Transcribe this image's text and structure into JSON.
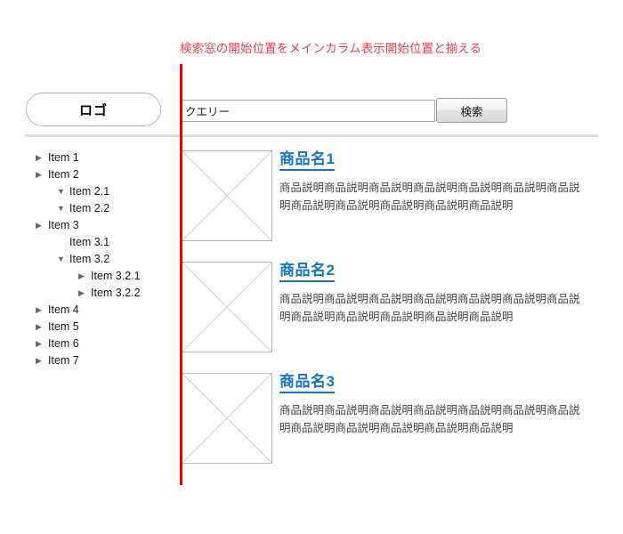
{
  "annotation": {
    "text": "検索窓の開始位置をメインカラム表示開始位置と揃える",
    "color": "#ee3b4d"
  },
  "guide_line": {
    "color": "#e60000"
  },
  "header": {
    "logo_label": "ロゴ",
    "search_value": "クエリー",
    "search_placeholder": "クエリー",
    "search_button_label": "検索"
  },
  "sidebar": {
    "items": [
      {
        "label": "Item 1",
        "depth": 0,
        "arrow": "collapsed"
      },
      {
        "label": "Item 2",
        "depth": 0,
        "arrow": "collapsed"
      },
      {
        "label": "Item 2.1",
        "depth": 1,
        "arrow": "expanded"
      },
      {
        "label": "Item 2.2",
        "depth": 1,
        "arrow": "expanded"
      },
      {
        "label": "Item 3",
        "depth": 0,
        "arrow": "collapsed"
      },
      {
        "label": "Item 3.1",
        "depth": 1,
        "arrow": "none"
      },
      {
        "label": "Item 3.2",
        "depth": 1,
        "arrow": "expanded"
      },
      {
        "label": "Item 3.2.1",
        "depth": 2,
        "arrow": "collapsed"
      },
      {
        "label": "Item 3.2.2",
        "depth": 2,
        "arrow": "collapsed"
      },
      {
        "label": "Item 4",
        "depth": 0,
        "arrow": "collapsed"
      },
      {
        "label": "Item 5",
        "depth": 0,
        "arrow": "collapsed"
      },
      {
        "label": "Item 6",
        "depth": 0,
        "arrow": "collapsed"
      },
      {
        "label": "Item 7",
        "depth": 0,
        "arrow": "collapsed"
      }
    ]
  },
  "main": {
    "products": [
      {
        "title": "商品名1",
        "description": "商品説明商品説明商品説明商品説明商品説明商品説明商品説明商品説明商品説明商品説明商品説明商品説明",
        "thumb": "image-placeholder"
      },
      {
        "title": "商品名2",
        "description": "商品説明商品説明商品説明商品説明商品説明商品説明商品説明商品説明商品説明商品説明商品説明商品説明",
        "thumb": "image-placeholder"
      },
      {
        "title": "商品名3",
        "description": "商品説明商品説明商品説明商品説明商品説明商品説明商品説明商品説明商品説明商品説明商品説明商品説明",
        "thumb": "image-placeholder"
      }
    ]
  },
  "colors": {
    "link": "#1573c8",
    "annotation": "#ee3b4d",
    "guide": "#e60000",
    "rule": "#dcdcdc"
  }
}
